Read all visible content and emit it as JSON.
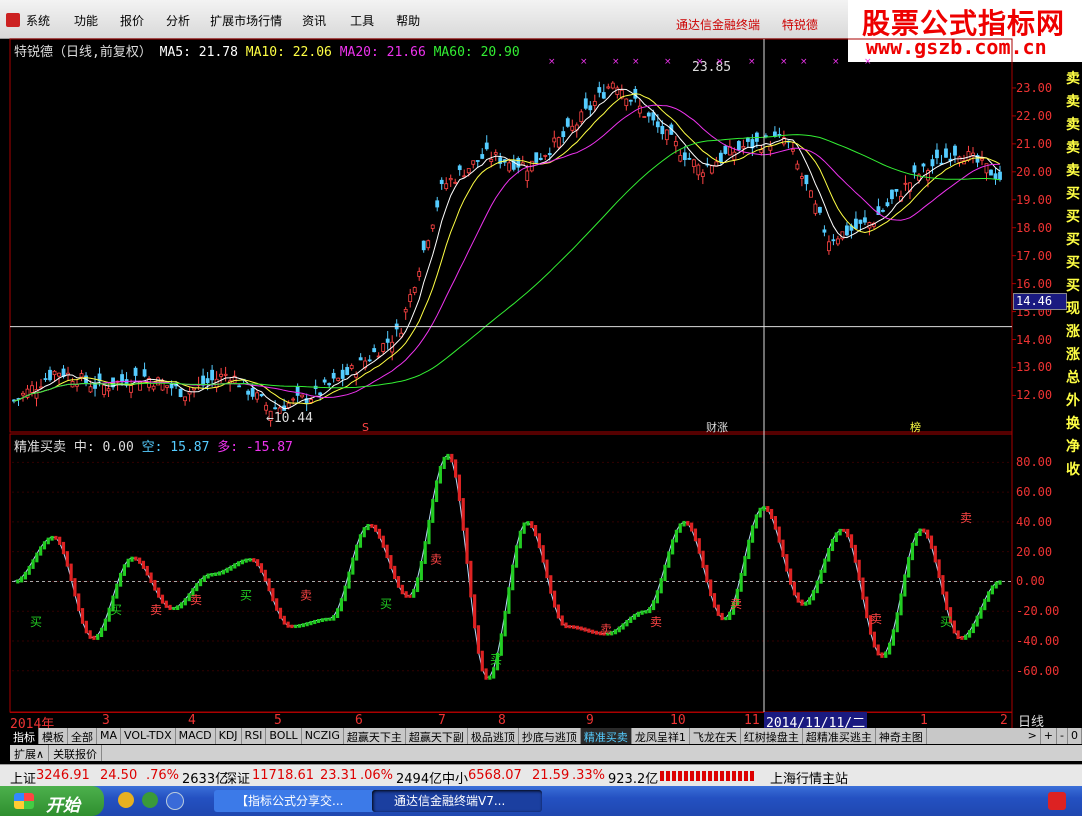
{
  "menu": {
    "items": [
      "系统",
      "功能",
      "报价",
      "分析",
      "扩展市场行情",
      "资讯",
      "工具",
      "帮助"
    ],
    "right": [
      "通达信金融终端",
      "特锐德"
    ]
  },
  "watermark": {
    "line1": "股票公式指标网",
    "line2": "www.gszb.com.cn"
  },
  "price_chart": {
    "title": "特锐德（日线,前复权）",
    "ma5": "MA5: 21.78",
    "ma10": "MA10: 22.06",
    "ma20": "MA20: 21.66",
    "ma60": "MA60: 20.90",
    "high_label": "23.85",
    "low_label": "10.44",
    "crosshair_price": "14.46",
    "marks": [
      "S",
      "财涨",
      "榜"
    ],
    "y_ticks": [
      "23.00",
      "22.00",
      "21.00",
      "20.00",
      "19.00",
      "18.00",
      "17.00",
      "16.00",
      "15.00",
      "14.00",
      "13.00",
      "12.00"
    ],
    "side_chars": [
      "卖",
      "卖",
      "卖",
      "卖",
      "卖",
      "买",
      "买",
      "买",
      "买",
      "买",
      "现",
      "涨",
      "涨",
      "总",
      "外",
      "换",
      "净",
      "收"
    ]
  },
  "indicator": {
    "name": "精准买卖",
    "mid": "中: 0.00",
    "kong": "空: 15.87",
    "duo": "多: -15.87",
    "y_ticks": [
      "80.00",
      "60.00",
      "40.00",
      "20.00",
      "0.00",
      "-20.00",
      "-40.00",
      "-60.00"
    ],
    "buy_label": "买",
    "sell_label": "卖"
  },
  "chart_data": {
    "type": "line",
    "x_labels": [
      "2014年",
      "3",
      "4",
      "5",
      "6",
      "7",
      "8",
      "9",
      "10",
      "11",
      "2014/11/11/二",
      "1",
      "2"
    ],
    "series": [
      {
        "name": "price",
        "values": [
          11.8,
          12.9,
          12.3,
          12.7,
          12.1,
          12.8,
          11.5,
          12.0,
          13.0,
          14.3,
          19.5,
          20.6,
          20.2,
          21.5,
          23.3,
          21.6,
          20.1,
          20.9,
          21.2,
          17.6,
          18.2,
          19.8,
          20.8,
          19.8
        ]
      },
      {
        "name": "精准买卖",
        "values": [
          0,
          30,
          -38,
          16,
          -18,
          5,
          15,
          -30,
          -25,
          38,
          -10,
          85,
          -65,
          40,
          -30,
          -35,
          -20,
          40,
          -25,
          50,
          -15,
          35,
          -50,
          35,
          -38,
          0
        ]
      }
    ],
    "ylim_price": [
      11.3,
      24.0
    ],
    "ylim_ind": [
      -85,
      95
    ]
  },
  "period": "日线",
  "tabs": [
    "指标",
    "模板",
    "全部",
    "MA",
    "VOL-TDX",
    "MACD",
    "KDJ",
    "RSI",
    "BOLL",
    "NCZIG",
    "超赢天下主",
    "超赢天下副",
    "极品逃顶",
    "抄底与逃顶",
    "精准买卖",
    "龙凤呈祥1",
    "飞龙在天",
    "红树操盘主",
    "超精准买逃主",
    "神奇主图",
    ">",
    "+",
    "-",
    "0"
  ],
  "subtabs": [
    "扩展∧",
    "关联报价"
  ],
  "ticker": {
    "sh_label": "上证",
    "sh_val": "3246.91",
    "sh_chg": "24.50",
    "sh_pct": ".76%",
    "sh_amt": "2633亿",
    "sz_label": "深证",
    "sz_val": "11718.61",
    "sz_chg": "23.31",
    "sz_pct": ".06%",
    "sz_amt": "2494亿",
    "zx_label": "中小",
    "zx_val": "6568.07",
    "zx_chg": "21.59",
    "zx_pct": ".33%",
    "zx_amt": "923.2亿",
    "station": "上海行情主站"
  },
  "taskbar": {
    "start": "开始",
    "tasks": [
      "【指标公式分享交...",
      "通达信金融终端V7..."
    ]
  }
}
